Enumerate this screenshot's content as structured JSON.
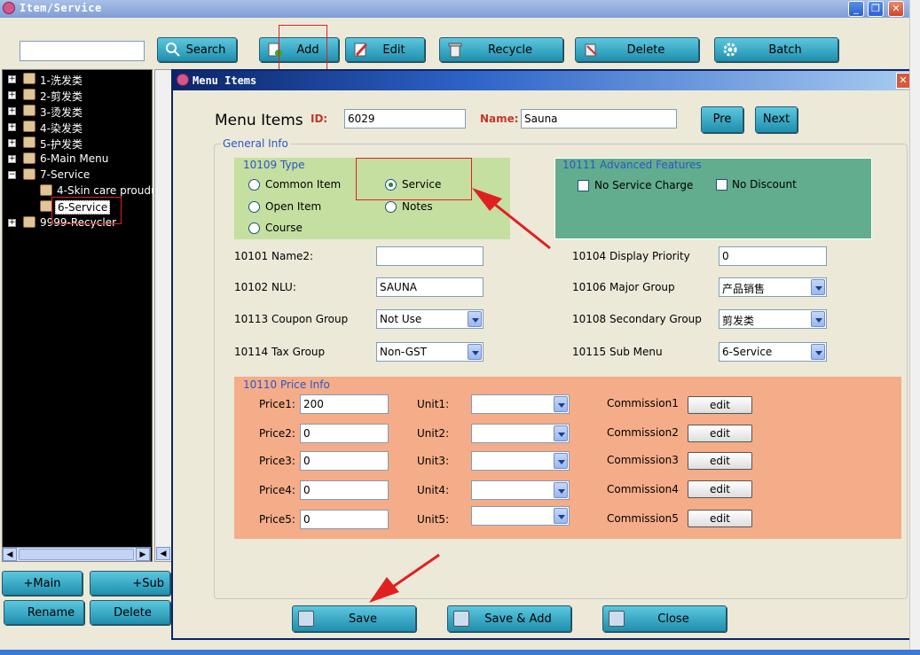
{
  "window": {
    "title": "Item/Service"
  },
  "toolbar": {
    "search_value": "",
    "search": "Search",
    "add": "Add",
    "edit": "Edit",
    "recycle": "Recycle",
    "delete": "Delete",
    "batch": "Batch"
  },
  "tree": {
    "items": [
      "1-洗发类",
      "2-剪发类",
      "3-烫发类",
      "4-染发类",
      "5-护发类",
      "6-Main Menu",
      "7-Service",
      "4-Skin care prouduct",
      "6-Service",
      "9999-Recycler"
    ]
  },
  "left_buttons": {
    "main": "+Main",
    "sub": "+Sub",
    "rename": "Rename",
    "delete": "Delete"
  },
  "dialog": {
    "title": "Menu Items",
    "heading": "Menu Items",
    "id_label": "ID:",
    "id_value": "6029",
    "name_label": "Name:",
    "name_value": "Sauna",
    "pre": "Pre",
    "next": "Next",
    "general_info": "General Info",
    "type": {
      "title": "10109 Type",
      "common": "Common Item",
      "service": "Service",
      "open": "Open Item",
      "notes": "Notes",
      "course": "Course",
      "selected": "Service"
    },
    "advanced": {
      "title": "10111 Advanced Features",
      "no_service_charge": "No Service Charge",
      "no_discount": "No Discount"
    },
    "fields": {
      "name2_label": "10101 Name2:",
      "name2_value": "",
      "nlu_label": "10102 NLU:",
      "nlu_value": "SAUNA",
      "coupon_label": "10113 Coupon Group",
      "coupon_value": "Not Use",
      "tax_label": "10114 Tax Group",
      "tax_value": "Non-GST",
      "display_label": "10104 Display Priority",
      "display_value": "0",
      "major_label": "10106 Major Group",
      "major_value": "产品销售",
      "secondary_label": "10108 Secondary Group",
      "secondary_value": "剪发类",
      "submenu_label": "10115 Sub Menu",
      "submenu_value": "6-Service"
    },
    "price": {
      "title": "10110 Price Info",
      "rows": [
        {
          "price_label": "Price1:",
          "price": "200",
          "unit_label": "Unit1:",
          "unit": "",
          "comm_label": "Commission1",
          "edit": "edit"
        },
        {
          "price_label": "Price2:",
          "price": "0",
          "unit_label": "Unit2:",
          "unit": "",
          "comm_label": "Commission2",
          "edit": "edit"
        },
        {
          "price_label": "Price3:",
          "price": "0",
          "unit_label": "Unit3:",
          "unit": "",
          "comm_label": "Commission3",
          "edit": "edit"
        },
        {
          "price_label": "Price4:",
          "price": "0",
          "unit_label": "Unit4:",
          "unit": "",
          "comm_label": "Commission4",
          "edit": "edit"
        },
        {
          "price_label": "Price5:",
          "price": "0",
          "unit_label": "Unit5:",
          "unit": "",
          "comm_label": "Commission5",
          "edit": "edit"
        }
      ]
    },
    "buttons": {
      "save": "Save",
      "save_add": "Save & Add",
      "close": "Close"
    }
  },
  "colors": {
    "button": "#2fa8c6",
    "type_box": "#c5dfa0",
    "advanced_box": "#62ad8d",
    "price_box": "#f4ad88",
    "annotation": "#e02020"
  }
}
